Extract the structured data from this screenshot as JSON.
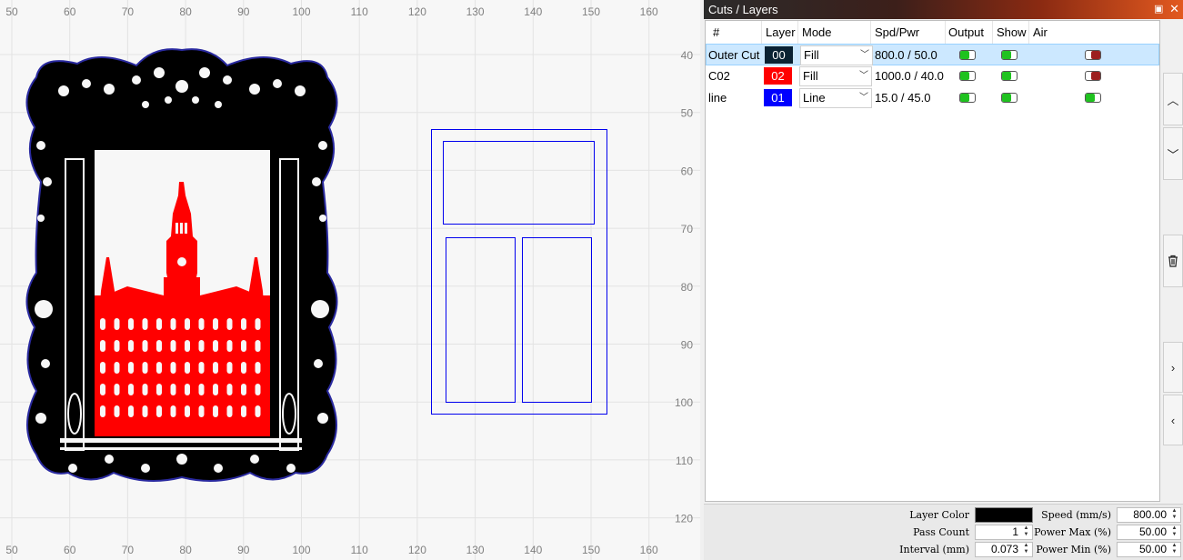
{
  "canvas": {
    "top_ruler": [
      "50",
      "60",
      "70",
      "80",
      "90",
      "100",
      "110",
      "120",
      "130",
      "140",
      "150",
      "160"
    ],
    "bottom_ruler": [
      "50",
      "60",
      "70",
      "80",
      "90",
      "100",
      "110",
      "120",
      "130",
      "140",
      "150",
      "160"
    ],
    "right_ruler": [
      "40",
      "50",
      "60",
      "70",
      "80",
      "90",
      "100",
      "110",
      "120"
    ],
    "colors": {
      "outer_cut": "#000000",
      "c02": "#ff0000",
      "line": "#0000ee"
    }
  },
  "panel": {
    "title": "Cuts / Layers",
    "columns": [
      "#",
      "Layer",
      "Mode",
      "Spd/Pwr",
      "Output",
      "Show",
      "Air"
    ],
    "rows": [
      {
        "name": "Outer Cut",
        "layer": "00",
        "layer_color": "#000000",
        "mode": "Fill",
        "spd_pwr": "800.0 / 50.0",
        "output": "on",
        "show": "on",
        "air": "off",
        "selected": true
      },
      {
        "name": "C02",
        "layer": "02",
        "layer_color": "#ff0000",
        "mode": "Fill",
        "spd_pwr": "1000.0 / 40.0",
        "output": "on",
        "show": "on",
        "air": "off",
        "selected": false
      },
      {
        "name": "line",
        "layer": "01",
        "layer_color": "#0000ff",
        "mode": "Line",
        "spd_pwr": "15.0 / 45.0",
        "output": "on",
        "show": "on",
        "air": "on",
        "selected": false
      }
    ],
    "side_buttons": [
      "chevron-up-icon",
      "chevron-down-icon",
      "trash-icon",
      "chevron-right-icon",
      "chevron-left-icon"
    ]
  },
  "settings": {
    "layer_color_label": "Layer Color",
    "layer_color": "#000000",
    "pass_count_label": "Pass Count",
    "pass_count": "1",
    "interval_label": "Interval (mm)",
    "interval": "0.073",
    "speed_label": "Speed (mm/s)",
    "speed": "800.00",
    "power_max_label": "Power Max (%)",
    "power_max": "50.00",
    "power_min_label": "Power Min (%)",
    "power_min": "50.00"
  }
}
